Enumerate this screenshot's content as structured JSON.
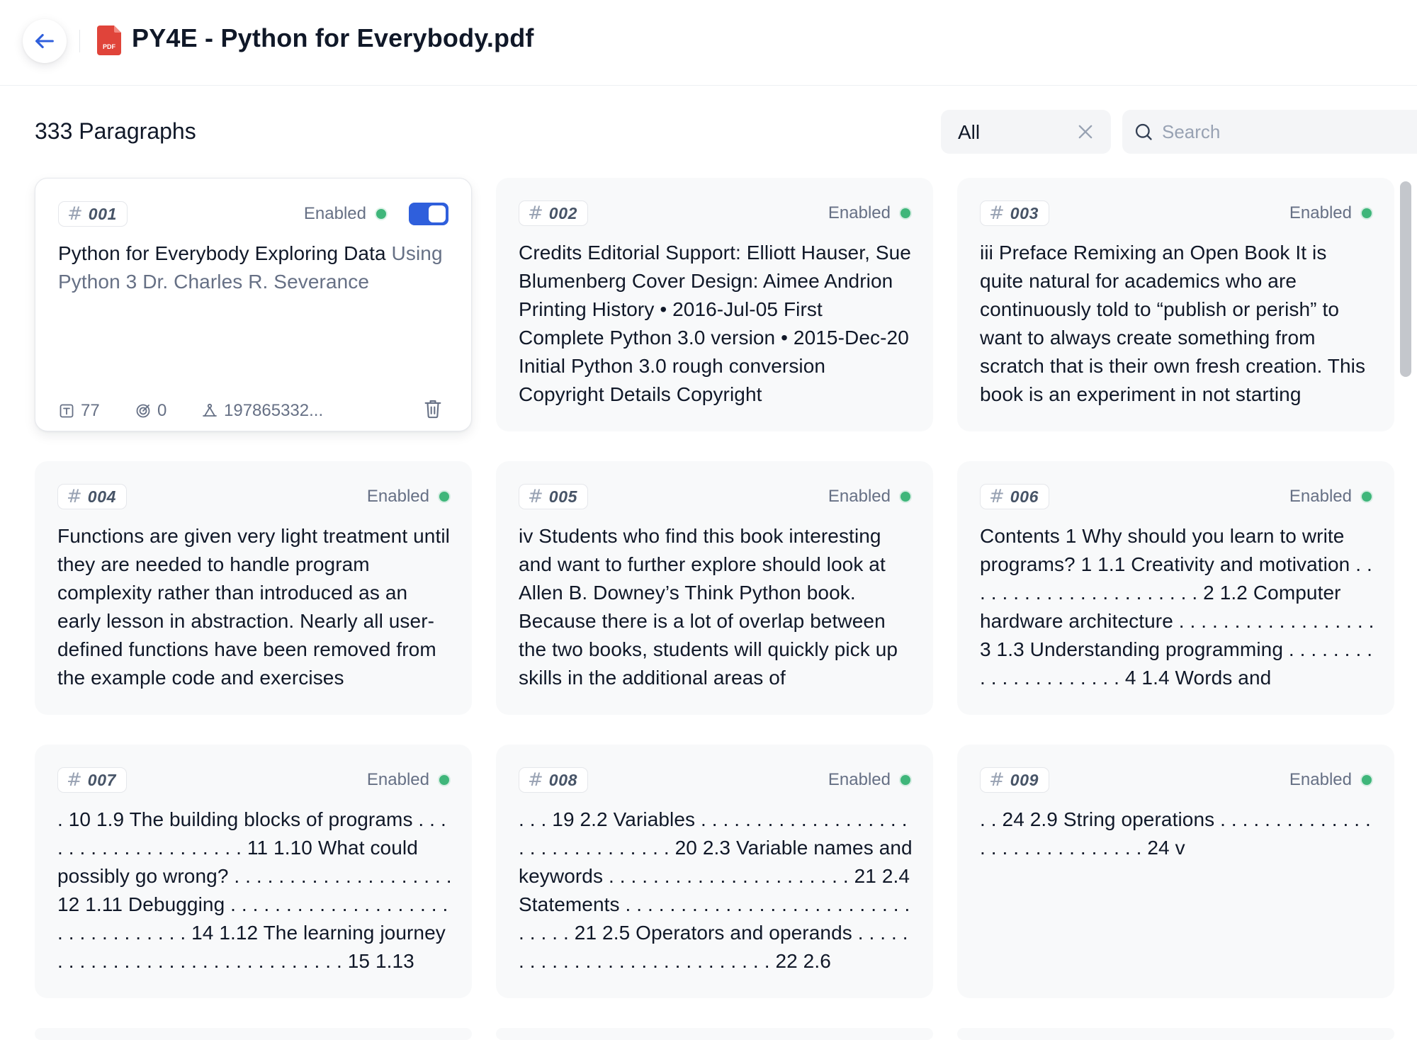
{
  "header": {
    "title": "PY4E - Python for Everybody.pdf",
    "file_icon_label": "PDF",
    "colors": {
      "pdf_red": "#e0443a",
      "back_arrow": "#2f5fdc"
    }
  },
  "toolbar": {
    "paragraph_count": "333 Paragraphs",
    "filter_value": "All",
    "search_placeholder": "Search"
  },
  "status_color": "#3fb67a",
  "cards": [
    {
      "id": "001",
      "status": "Enabled",
      "toggle_on": true,
      "text_main": "Python for Everybody Exploring Data",
      "text_muted": "Using Python 3 Dr. Charles R. Severance",
      "meta": {
        "chars": "77",
        "hits": "0",
        "hash": "197865332..."
      }
    },
    {
      "id": "002",
      "status": "Enabled",
      "text_main": "Credits Editorial Support: Elliott Hauser, Sue Blumenberg Cover Design: Aimee Andrion Printing History • 2016-Jul-05 First Complete Python 3.0 version • 2015-Dec-20 Initial Python 3.0 rough conversion Copyright Details Copyright"
    },
    {
      "id": "003",
      "status": "Enabled",
      "text_main": "iii Preface Remixing an Open Book It is quite natural for academics who are continuously told to “publish or perish” to want to always create something from scratch that is their own fresh creation. This book is an experiment in not starting"
    },
    {
      "id": "004",
      "status": "Enabled",
      "text_main": "Functions are given very light treatment until they are needed to handle program complexity rather than introduced as an early lesson in abstraction. Nearly all user-defined functions have been removed from the example code and exercises"
    },
    {
      "id": "005",
      "status": "Enabled",
      "text_main": "iv Students who find this book interesting and want to further explore should look at Allen B. Downey’s Think Python book. Because there is a lot of overlap between the two books, students will quickly pick up skills in the additional areas of"
    },
    {
      "id": "006",
      "status": "Enabled",
      "text_main": "Contents 1 Why should you learn to write programs? 1 1.1 Creativity and motivation . . . . . . . . . . . . . . . . . . . . . . 2 1.2 Computer hardware architecture . . . . . . . . . . . . . . . . . . 3 1.3 Understanding programming . . . . . . . . . . . . . . . . . . . . . 4 1.4 Words and"
    },
    {
      "id": "007",
      "status": "Enabled",
      "text_main": ". 10 1.9 The building blocks of programs . . . . . . . . . . . . . . . . . . . . 11 1.10 What could possibly go wrong? . . . . . . . . . . . . . . . . . . . . 12 1.11 Debugging . . . . . . . . . . . . . . . . . . . . . . . . . . . . . . . . 14 1.12 The learning journey . . . . . . . . . . . . . . . . . . . . . . . . . . 15 1.13"
    },
    {
      "id": "008",
      "status": "Enabled",
      "text_main": ". . . 19 2.2 Variables . . . . . . . . . . . . . . . . . . . . . . . . . . . . . . . . . 20 2.3 Variable names and keywords . . . . . . . . . . . . . . . . . . . . . . 21 2.4 Statements . . . . . . . . . . . . . . . . . . . . . . . . . . . . . . . 21 2.5 Operators and operands . . . . . . . . . . . . . . . . . . . . . . . . . . . . 22 2.6"
    },
    {
      "id": "009",
      "status": "Enabled",
      "text_main": ". . 24 2.9 String operations . . . . . . . . . . . . . . . . . . . . . . . . . . . . . 24 v"
    }
  ]
}
